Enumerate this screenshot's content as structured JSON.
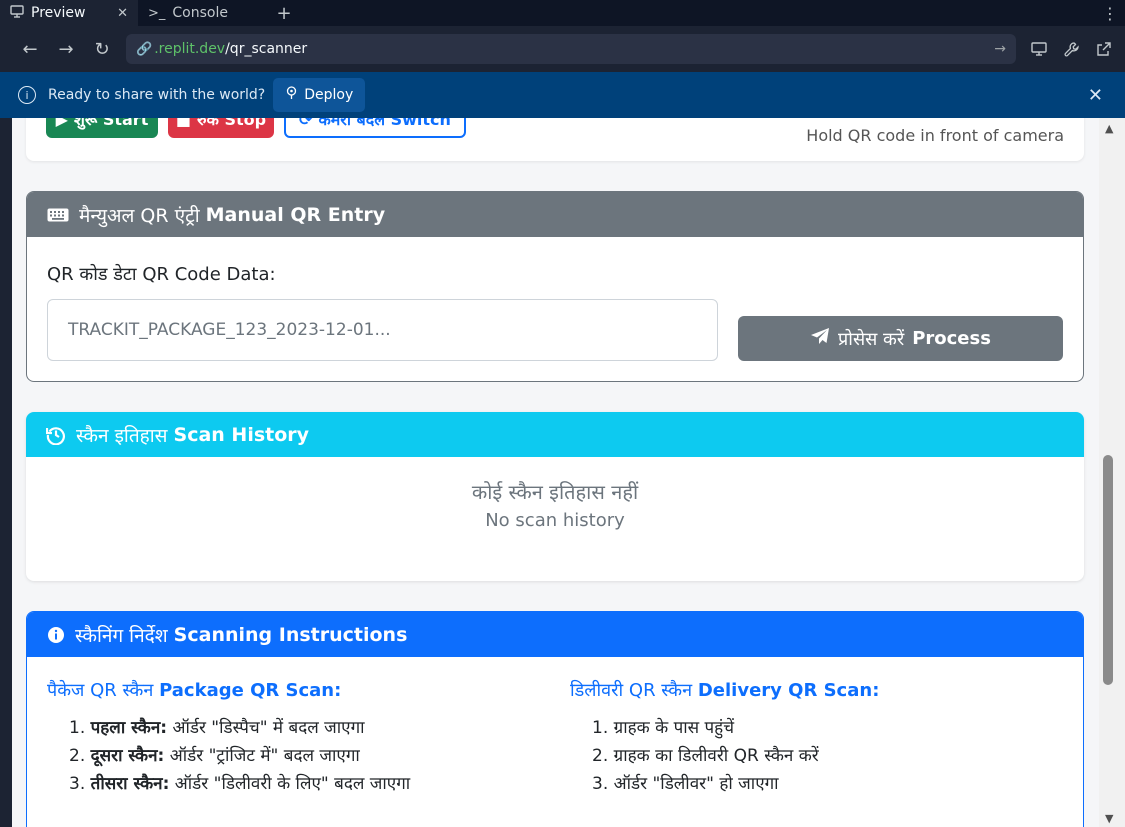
{
  "browser": {
    "tabs": [
      {
        "label": "Preview",
        "icon": "monitor-icon",
        "active": true
      },
      {
        "label": "Console",
        "icon": "terminal-icon",
        "active": false
      }
    ],
    "url_domain": ".replit.dev",
    "url_path": "/qr_scanner"
  },
  "banner": {
    "message": "Ready to share with the world?",
    "deploy_label": "Deploy"
  },
  "camera": {
    "start_label": "शुरू Start",
    "stop_label": "रुकें Stop",
    "switch_label": "कैमरा बदलें Switch",
    "hint": "Hold QR code in front of camera"
  },
  "manual_entry": {
    "title_hi": "मैन्युअल QR एंट्री",
    "title_en": "Manual QR Entry",
    "field_label": "QR कोड डेटा QR Code Data:",
    "placeholder": "TRACKIT_PACKAGE_123_2023-12-01...",
    "process_hi": "प्रोसेस करें",
    "process_en": "Process"
  },
  "history": {
    "title_hi": "स्कैन इतिहास",
    "title_en": "Scan History",
    "empty_hi": "कोई स्कैन इतिहास नहीं",
    "empty_en": "No scan history"
  },
  "instructions": {
    "title_hi": "स्कैनिंग निर्देश",
    "title_en": "Scanning Instructions",
    "package": {
      "title_hi": "पैकेज QR स्कैन",
      "title_en": "Package QR Scan:",
      "steps": [
        {
          "bold": "पहला स्कैन:",
          "text": " ऑर्डर \"डिस्पैच\" में बदल जाएगा"
        },
        {
          "bold": "दूसरा स्कैन:",
          "text": " ऑर्डर \"ट्रांजिट में\" बदल जाएगा"
        },
        {
          "bold": "तीसरा स्कैन:",
          "text": " ऑर्डर \"डिलीवरी के लिए\" बदल जाएगा"
        }
      ]
    },
    "delivery": {
      "title_hi": "डिलीवरी QR स्कैन",
      "title_en": "Delivery QR Scan:",
      "steps": [
        "ग्राहक के पास पहुंचें",
        "ग्राहक का डिलीवरी QR स्कैन करें",
        "ऑर्डर \"डिलीवर\" हो जाएगा"
      ]
    }
  }
}
